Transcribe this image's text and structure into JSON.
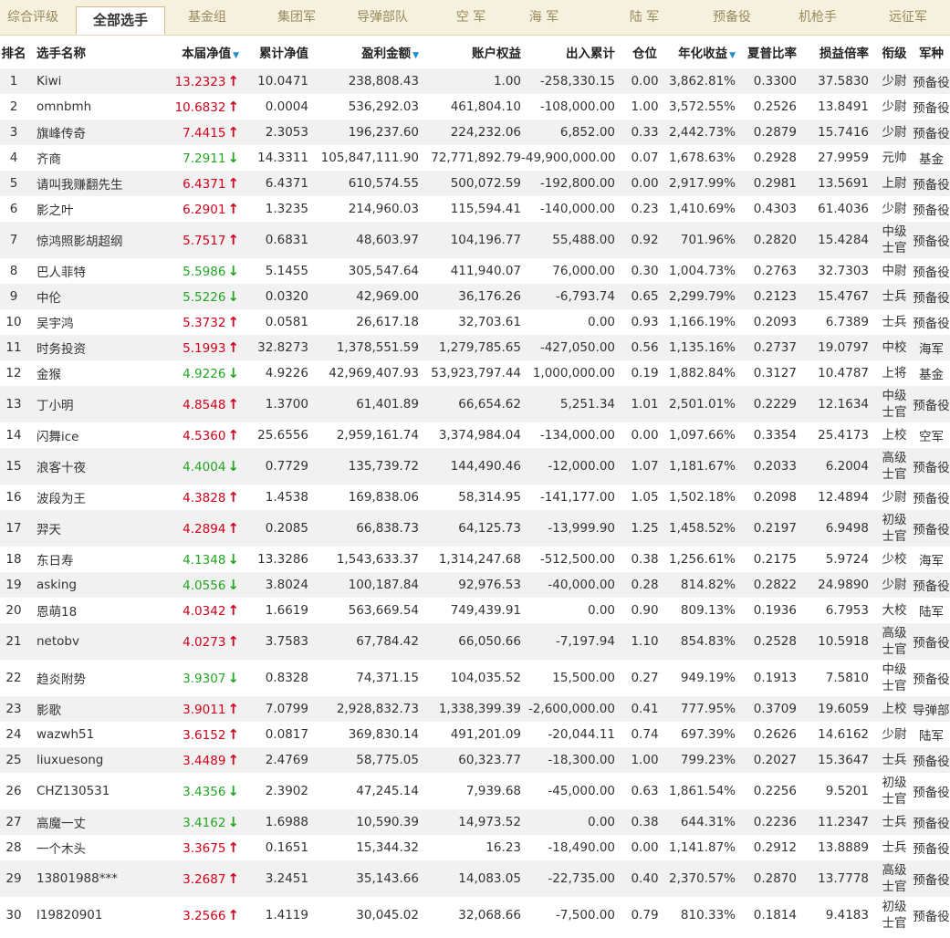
{
  "tabs": [
    {
      "label": "综合评级",
      "active": false
    },
    {
      "label": "全部选手",
      "active": true
    },
    {
      "label": "基金组",
      "active": false
    },
    {
      "label": "集团军",
      "active": false
    },
    {
      "label": "导弹部队",
      "active": false
    },
    {
      "label": "空 军",
      "active": false
    },
    {
      "label": "海 军",
      "active": false
    },
    {
      "label": "陆 军",
      "active": false
    },
    {
      "label": "预备役",
      "active": false
    },
    {
      "label": "机枪手",
      "active": false
    },
    {
      "label": "远征军",
      "active": false
    }
  ],
  "columns": [
    {
      "label": "排名",
      "sort": false
    },
    {
      "label": "选手名称",
      "sort": false
    },
    {
      "label": "本届净值",
      "sort": true
    },
    {
      "label": "累计净值",
      "sort": false
    },
    {
      "label": "盈利金额",
      "sort": true
    },
    {
      "label": "账户权益",
      "sort": false
    },
    {
      "label": "出入累计",
      "sort": false
    },
    {
      "label": "仓位",
      "sort": false
    },
    {
      "label": "年化收益",
      "sort": true
    },
    {
      "label": "夏普比率",
      "sort": false
    },
    {
      "label": "损益倍率",
      "sort": false
    },
    {
      "label": "衔级",
      "sort": false
    },
    {
      "label": "军种",
      "sort": false
    }
  ],
  "colors": {
    "up": "#d0021b",
    "down": "#21a621",
    "sort_arrow": "#1a8ccf"
  },
  "rows": [
    {
      "rank": "1",
      "name": "Kiwi",
      "nav": "13.2323",
      "trend": "up",
      "cum": "10.0471",
      "profit": "238,808.43",
      "equity": "1.00",
      "flow": "-258,330.15",
      "pos": "0.00",
      "annual": "3,862.81%",
      "sharpe": "0.3300",
      "pl": "37.5830",
      "rank_title": "少尉",
      "branch": "预备役"
    },
    {
      "rank": "2",
      "name": "omnbmh",
      "nav": "10.6832",
      "trend": "up",
      "cum": "0.0004",
      "profit": "536,292.03",
      "equity": "461,804.10",
      "flow": "-108,000.00",
      "pos": "1.00",
      "annual": "3,572.55%",
      "sharpe": "0.2526",
      "pl": "13.8491",
      "rank_title": "少尉",
      "branch": "预备役"
    },
    {
      "rank": "3",
      "name": "旗峰传奇",
      "nav": "7.4415",
      "trend": "up",
      "cum": "2.3053",
      "profit": "196,237.60",
      "equity": "224,232.06",
      "flow": "6,852.00",
      "pos": "0.33",
      "annual": "2,442.73%",
      "sharpe": "0.2879",
      "pl": "15.7416",
      "rank_title": "少尉",
      "branch": "预备役"
    },
    {
      "rank": "4",
      "name": "齐商",
      "nav": "7.2911",
      "trend": "down",
      "cum": "14.3311",
      "profit": "105,847,111.90",
      "equity": "72,771,892.79",
      "flow": "-49,900,000.00",
      "pos": "0.07",
      "annual": "1,678.63%",
      "sharpe": "0.2928",
      "pl": "27.9959",
      "rank_title": "元帅",
      "branch": "基金"
    },
    {
      "rank": "5",
      "name": "请叫我赚翻先生",
      "nav": "6.4371",
      "trend": "up",
      "cum": "6.4371",
      "profit": "610,574.55",
      "equity": "500,072.59",
      "flow": "-192,800.00",
      "pos": "0.00",
      "annual": "2,917.99%",
      "sharpe": "0.2981",
      "pl": "13.5691",
      "rank_title": "上尉",
      "branch": "预备役"
    },
    {
      "rank": "6",
      "name": "影之叶",
      "nav": "6.2901",
      "trend": "up",
      "cum": "1.3235",
      "profit": "214,960.03",
      "equity": "115,594.41",
      "flow": "-140,000.00",
      "pos": "0.23",
      "annual": "1,410.69%",
      "sharpe": "0.4303",
      "pl": "61.4036",
      "rank_title": "少尉",
      "branch": "预备役"
    },
    {
      "rank": "7",
      "name": "惊鸿照影胡超纲",
      "nav": "5.7517",
      "trend": "up",
      "cum": "0.6831",
      "profit": "48,603.97",
      "equity": "104,196.77",
      "flow": "55,488.00",
      "pos": "0.92",
      "annual": "701.96%",
      "sharpe": "0.2820",
      "pl": "15.4284",
      "rank_title": "中级士官",
      "branch": "预备役"
    },
    {
      "rank": "8",
      "name": "巴人菲特",
      "nav": "5.5986",
      "trend": "down",
      "cum": "5.1455",
      "profit": "305,547.64",
      "equity": "411,940.07",
      "flow": "76,000.00",
      "pos": "0.30",
      "annual": "1,004.73%",
      "sharpe": "0.2763",
      "pl": "32.7303",
      "rank_title": "中尉",
      "branch": "预备役"
    },
    {
      "rank": "9",
      "name": "中伦",
      "nav": "5.5226",
      "trend": "down",
      "cum": "0.0320",
      "profit": "42,969.00",
      "equity": "36,176.26",
      "flow": "-6,793.74",
      "pos": "0.65",
      "annual": "2,299.79%",
      "sharpe": "0.2123",
      "pl": "15.4767",
      "rank_title": "士兵",
      "branch": "预备役"
    },
    {
      "rank": "10",
      "name": "吴宇鸿",
      "nav": "5.3732",
      "trend": "up",
      "cum": "0.0581",
      "profit": "26,617.18",
      "equity": "32,703.61",
      "flow": "0.00",
      "pos": "0.93",
      "annual": "1,166.19%",
      "sharpe": "0.2093",
      "pl": "6.7389",
      "rank_title": "士兵",
      "branch": "预备役"
    },
    {
      "rank": "11",
      "name": "时务投资",
      "nav": "5.1993",
      "trend": "up",
      "cum": "32.8273",
      "profit": "1,378,551.59",
      "equity": "1,279,785.65",
      "flow": "-427,050.00",
      "pos": "0.56",
      "annual": "1,135.16%",
      "sharpe": "0.2737",
      "pl": "19.0797",
      "rank_title": "中校",
      "branch": "海军"
    },
    {
      "rank": "12",
      "name": "金猴",
      "nav": "4.9226",
      "trend": "down",
      "cum": "4.9226",
      "profit": "42,969,407.93",
      "equity": "53,923,797.44",
      "flow": "1,000,000.00",
      "pos": "0.19",
      "annual": "1,882.84%",
      "sharpe": "0.3127",
      "pl": "10.4787",
      "rank_title": "上将",
      "branch": "基金"
    },
    {
      "rank": "13",
      "name": "丁小明",
      "nav": "4.8548",
      "trend": "up",
      "cum": "1.3700",
      "profit": "61,401.89",
      "equity": "66,654.62",
      "flow": "5,251.34",
      "pos": "1.01",
      "annual": "2,501.01%",
      "sharpe": "0.2229",
      "pl": "12.1634",
      "rank_title": "中级士官",
      "branch": "预备役"
    },
    {
      "rank": "14",
      "name": "闪舞ice",
      "nav": "4.5360",
      "trend": "up",
      "cum": "25.6556",
      "profit": "2,959,161.74",
      "equity": "3,374,984.04",
      "flow": "-134,000.00",
      "pos": "0.00",
      "annual": "1,097.66%",
      "sharpe": "0.3354",
      "pl": "25.4173",
      "rank_title": "上校",
      "branch": "空军"
    },
    {
      "rank": "15",
      "name": "浪客十夜",
      "nav": "4.4004",
      "trend": "down",
      "cum": "0.7729",
      "profit": "135,739.72",
      "equity": "144,490.46",
      "flow": "-12,000.00",
      "pos": "1.07",
      "annual": "1,181.67%",
      "sharpe": "0.2033",
      "pl": "6.2004",
      "rank_title": "高级士官",
      "branch": "预备役"
    },
    {
      "rank": "16",
      "name": "波段为王",
      "nav": "4.3828",
      "trend": "up",
      "cum": "1.4538",
      "profit": "169,838.06",
      "equity": "58,314.95",
      "flow": "-141,177.00",
      "pos": "1.05",
      "annual": "1,502.18%",
      "sharpe": "0.2098",
      "pl": "12.4894",
      "rank_title": "少尉",
      "branch": "预备役"
    },
    {
      "rank": "17",
      "name": "羿天",
      "nav": "4.2894",
      "trend": "up",
      "cum": "0.2085",
      "profit": "66,838.73",
      "equity": "64,125.73",
      "flow": "-13,999.90",
      "pos": "1.25",
      "annual": "1,458.52%",
      "sharpe": "0.2197",
      "pl": "6.9498",
      "rank_title": "初级士官",
      "branch": "预备役"
    },
    {
      "rank": "18",
      "name": "东日寿",
      "nav": "4.1348",
      "trend": "down",
      "cum": "13.3286",
      "profit": "1,543,633.37",
      "equity": "1,314,247.68",
      "flow": "-512,500.00",
      "pos": "0.38",
      "annual": "1,256.61%",
      "sharpe": "0.2175",
      "pl": "5.9724",
      "rank_title": "少校",
      "branch": "海军"
    },
    {
      "rank": "19",
      "name": "asking",
      "nav": "4.0556",
      "trend": "down",
      "cum": "3.8024",
      "profit": "100,187.84",
      "equity": "92,976.53",
      "flow": "-40,000.00",
      "pos": "0.28",
      "annual": "814.82%",
      "sharpe": "0.2822",
      "pl": "24.9890",
      "rank_title": "少尉",
      "branch": "预备役"
    },
    {
      "rank": "20",
      "name": "恩萌18",
      "nav": "4.0342",
      "trend": "up",
      "cum": "1.6619",
      "profit": "563,669.54",
      "equity": "749,439.91",
      "flow": "0.00",
      "pos": "0.90",
      "annual": "809.13%",
      "sharpe": "0.1936",
      "pl": "6.7953",
      "rank_title": "大校",
      "branch": "陆军"
    },
    {
      "rank": "21",
      "name": "netobv",
      "nav": "4.0273",
      "trend": "up",
      "cum": "3.7583",
      "profit": "67,784.42",
      "equity": "66,050.66",
      "flow": "-7,197.94",
      "pos": "1.10",
      "annual": "854.83%",
      "sharpe": "0.2528",
      "pl": "10.5918",
      "rank_title": "高级士官",
      "branch": "预备役"
    },
    {
      "rank": "22",
      "name": "趋炎附势",
      "nav": "3.9307",
      "trend": "down",
      "cum": "0.8328",
      "profit": "74,371.15",
      "equity": "104,035.52",
      "flow": "15,500.00",
      "pos": "0.27",
      "annual": "949.19%",
      "sharpe": "0.1913",
      "pl": "7.5810",
      "rank_title": "中级士官",
      "branch": "预备役"
    },
    {
      "rank": "23",
      "name": "影歌",
      "nav": "3.9011",
      "trend": "up",
      "cum": "7.0799",
      "profit": "2,928,832.73",
      "equity": "1,338,399.39",
      "flow": "-2,600,000.00",
      "pos": "0.41",
      "annual": "777.95%",
      "sharpe": "0.3709",
      "pl": "19.6059",
      "rank_title": "上校",
      "branch": "导弹部队"
    },
    {
      "rank": "24",
      "name": "wazwh51",
      "nav": "3.6152",
      "trend": "up",
      "cum": "0.0817",
      "profit": "369,830.14",
      "equity": "491,201.09",
      "flow": "-20,044.11",
      "pos": "0.74",
      "annual": "697.39%",
      "sharpe": "0.2626",
      "pl": "14.6162",
      "rank_title": "少尉",
      "branch": "陆军"
    },
    {
      "rank": "25",
      "name": "liuxuesong",
      "nav": "3.4489",
      "trend": "up",
      "cum": "2.4769",
      "profit": "58,775.05",
      "equity": "60,323.77",
      "flow": "-18,300.00",
      "pos": "1.00",
      "annual": "799.23%",
      "sharpe": "0.2027",
      "pl": "15.3647",
      "rank_title": "士兵",
      "branch": "预备役"
    },
    {
      "rank": "26",
      "name": "CHZ130531",
      "nav": "3.4356",
      "trend": "down",
      "cum": "2.3902",
      "profit": "47,245.14",
      "equity": "7,939.68",
      "flow": "-45,000.00",
      "pos": "0.63",
      "annual": "1,861.54%",
      "sharpe": "0.2256",
      "pl": "9.5201",
      "rank_title": "初级士官",
      "branch": "预备役"
    },
    {
      "rank": "27",
      "name": "高魔一丈",
      "nav": "3.4162",
      "trend": "down",
      "cum": "1.6988",
      "profit": "10,590.39",
      "equity": "14,973.52",
      "flow": "0.00",
      "pos": "0.38",
      "annual": "644.31%",
      "sharpe": "0.2236",
      "pl": "11.2347",
      "rank_title": "士兵",
      "branch": "预备役"
    },
    {
      "rank": "28",
      "name": "一个木头",
      "nav": "3.3675",
      "trend": "up",
      "cum": "0.1651",
      "profit": "15,344.32",
      "equity": "16.23",
      "flow": "-18,490.00",
      "pos": "0.00",
      "annual": "1,141.87%",
      "sharpe": "0.2912",
      "pl": "13.8889",
      "rank_title": "士兵",
      "branch": "预备役"
    },
    {
      "rank": "29",
      "name": "13801988***",
      "nav": "3.2687",
      "trend": "up",
      "cum": "3.2451",
      "profit": "35,143.66",
      "equity": "14,083.05",
      "flow": "-22,735.00",
      "pos": "0.40",
      "annual": "2,370.57%",
      "sharpe": "0.2870",
      "pl": "13.7778",
      "rank_title": "高级士官",
      "branch": "预备役"
    },
    {
      "rank": "30",
      "name": "l19820901",
      "nav": "3.2566",
      "trend": "up",
      "cum": "1.4119",
      "profit": "30,045.02",
      "equity": "32,068.66",
      "flow": "-7,500.00",
      "pos": "0.79",
      "annual": "810.33%",
      "sharpe": "0.1814",
      "pl": "9.4183",
      "rank_title": "初级士官",
      "branch": "预备役"
    }
  ]
}
